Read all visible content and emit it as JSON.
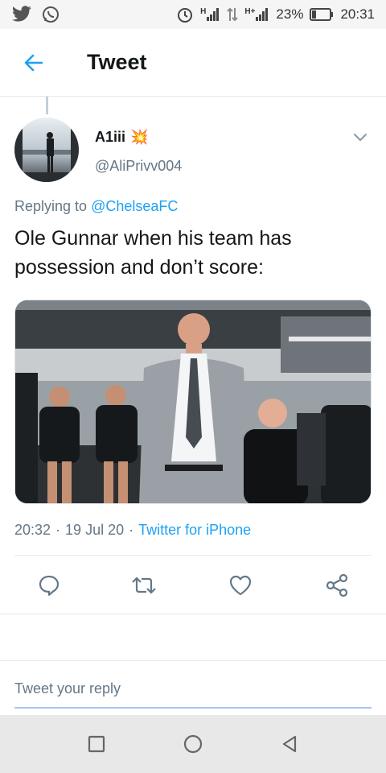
{
  "status_bar": {
    "left_icons": [
      "twitter-icon",
      "whatsapp-icon"
    ],
    "right_icons": [
      "alarm-icon",
      "signal-icon",
      "data-arrows-icon",
      "signal-icon"
    ],
    "network_1": "H",
    "network_2": "H+",
    "battery_percent": "23%",
    "time": "20:31"
  },
  "header": {
    "title": "Tweet"
  },
  "tweet": {
    "display_name": "A1iii",
    "name_emoji": "💥",
    "handle": "@AliPrivv004",
    "replying_prefix": "Replying to",
    "replying_to": "@ChelseaFC",
    "text": "Ole Gunnar when his team has possession and don’t score:",
    "time": "20:32",
    "date": "19 Jul 20",
    "client": "Twitter for iPhone",
    "separator": "·"
  },
  "actions": [
    "reply-icon",
    "retweet-icon",
    "like-icon",
    "share-icon"
  ],
  "composer": {
    "placeholder": "Tweet your reply"
  },
  "nav": [
    "recents-icon",
    "home-icon",
    "back-icon"
  ],
  "colors": {
    "accent": "#1da1f2",
    "muted": "#657786",
    "border": "#e1e8ed"
  }
}
